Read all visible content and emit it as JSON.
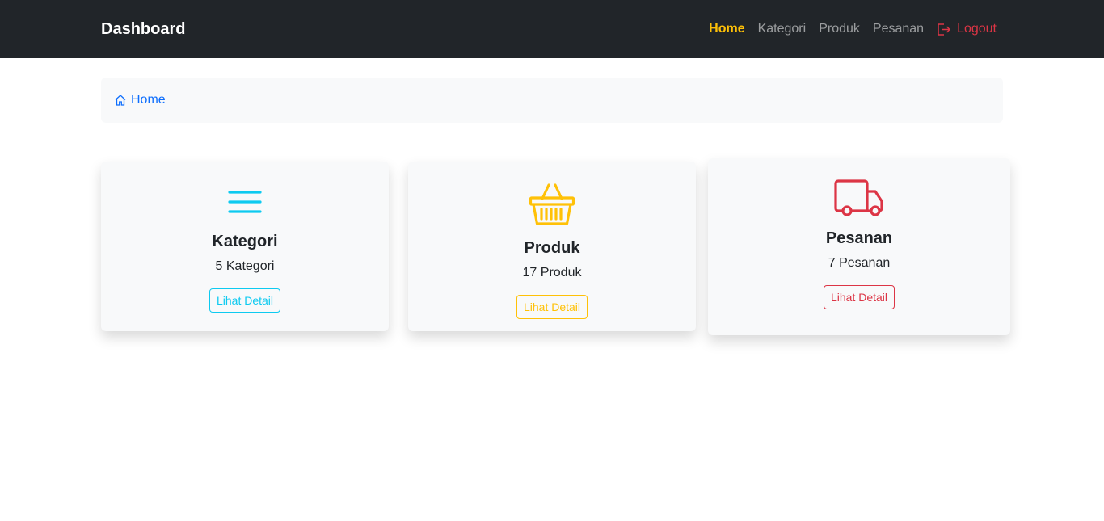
{
  "navbar": {
    "brand": "Dashboard",
    "links": [
      "Home",
      "Kategori",
      "Produk",
      "Pesanan"
    ],
    "logout": "Logout"
  },
  "breadcrumb": {
    "home": "Home"
  },
  "cards": [
    {
      "title": "Kategori",
      "count": "5 Kategori",
      "button": "Lihat Detail",
      "icon": "list-icon",
      "color": "#0dcaf0"
    },
    {
      "title": "Produk",
      "count": "17 Produk",
      "button": "Lihat Detail",
      "icon": "basket-icon",
      "color": "#ffc107"
    },
    {
      "title": "Pesanan",
      "count": "7 Pesanan",
      "button": "Lihat Detail",
      "icon": "truck-icon",
      "color": "#dc3545"
    }
  ],
  "colors": {
    "navbar_bg": "#212529",
    "active": "#ffc107",
    "logout": "#dc3545",
    "link": "#0d6efd"
  }
}
